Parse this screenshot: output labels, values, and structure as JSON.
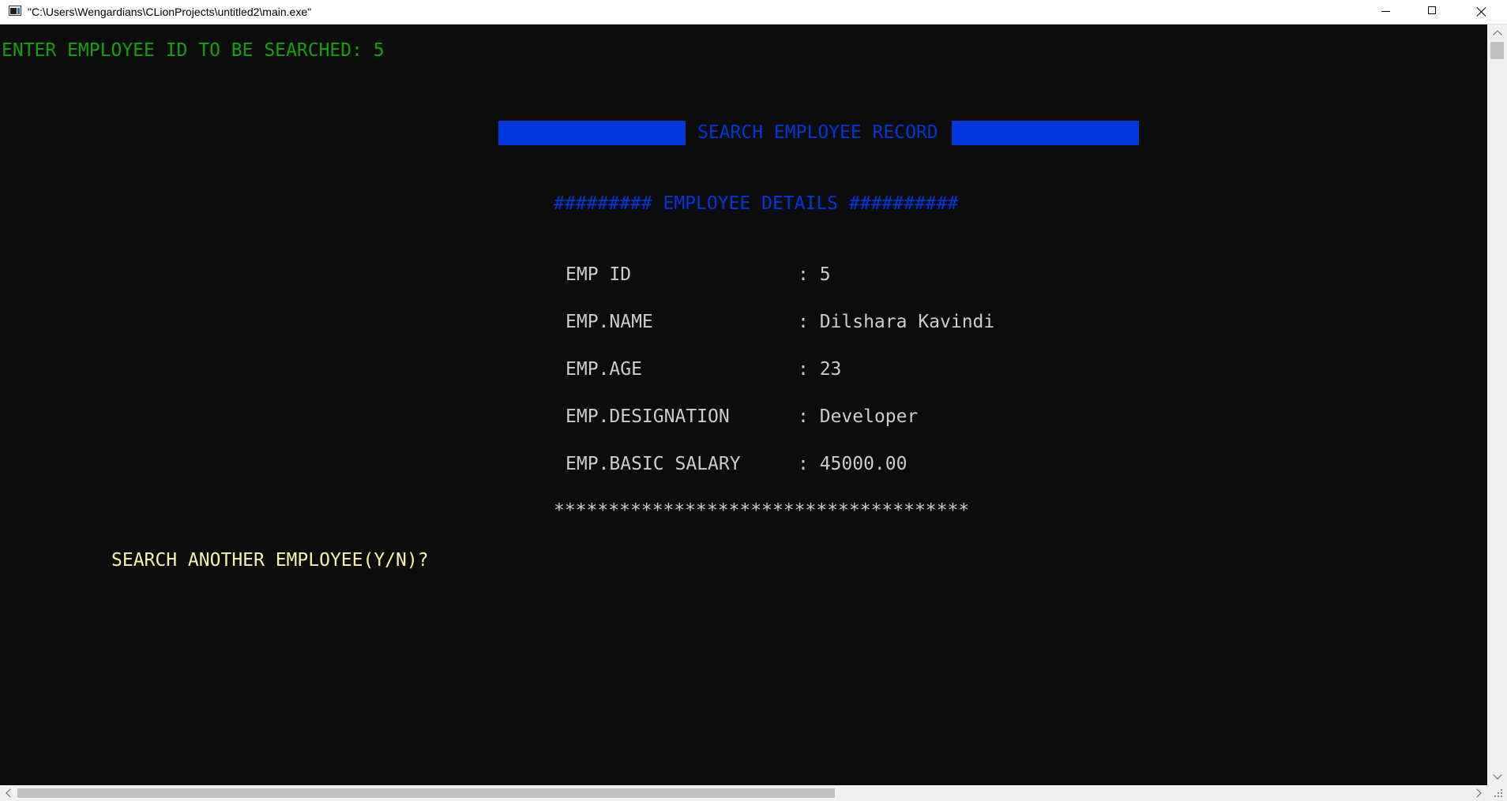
{
  "window": {
    "title": "\"C:\\Users\\Wengardians\\CLionProjects\\untitled2\\main.exe\"",
    "icon": "console-app-icon",
    "buttons": [
      "minimize-icon",
      "maximize-icon",
      "close-icon"
    ]
  },
  "console": {
    "colors": {
      "background": "#0c0c0c",
      "prompt": "#13a10e",
      "header": "#0037da",
      "text": "#cccccc",
      "question": "#f9f1a5"
    },
    "prompt": "ENTER EMPLOYEE ID TO BE SEARCHED: 5",
    "header_title": "SEARCH EMPLOYEE RECORD",
    "details_heading": "######### EMPLOYEE DETAILS ##########",
    "fields": [
      {
        "label": "EMP ID",
        "value": ": 5"
      },
      {
        "label": "EMP.NAME",
        "value": ": Dilshara Kavindi"
      },
      {
        "label": "EMP.AGE",
        "value": ": 23"
      },
      {
        "label": "EMP.DESIGNATION",
        "value": ": Developer"
      },
      {
        "label": "EMP.BASIC SALARY",
        "value": ": 45000.00"
      }
    ],
    "separator": "**************************************",
    "question": "SEARCH ANOTHER EMPLOYEE(Y/N)?"
  }
}
